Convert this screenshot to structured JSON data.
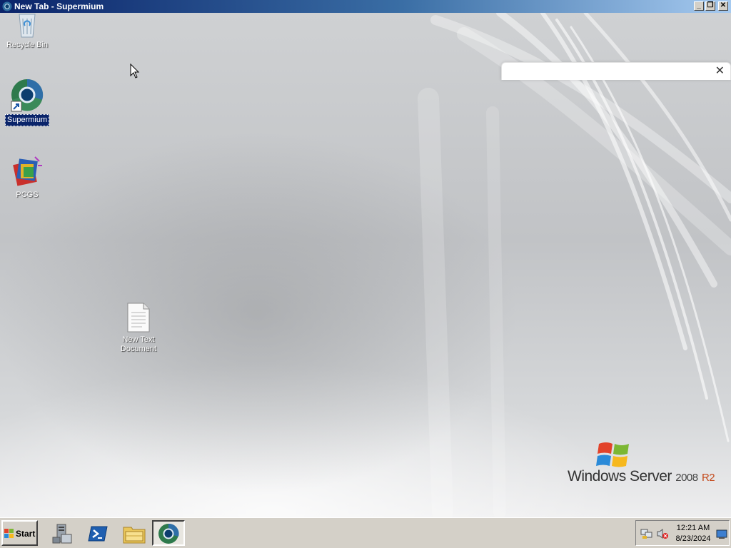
{
  "window": {
    "title": "New Tab - Supermium",
    "minimize_glyph": "_",
    "maximize_glyph": "❐",
    "close_glyph": "✕"
  },
  "desktop": {
    "icons": [
      {
        "label": "Recycle Bin",
        "icon": "recycle-bin-icon",
        "selected": false
      },
      {
        "label": "Supermium",
        "icon": "supermium-icon",
        "selected": true
      },
      {
        "label": "PCGS",
        "icon": "pcgs-icon",
        "selected": false
      },
      {
        "label": "New Text Document",
        "icon": "text-document-icon",
        "selected": false
      }
    ],
    "popup": {
      "close_glyph": "✕"
    },
    "logo": {
      "brand": "Windows Server",
      "version": "2008",
      "edition": "R2"
    }
  },
  "taskbar": {
    "start_label": "Start",
    "pinned": [
      {
        "icon": "server-manager-icon"
      },
      {
        "icon": "powershell-icon"
      },
      {
        "icon": "file-explorer-icon"
      },
      {
        "icon": "supermium-icon",
        "active": true
      }
    ],
    "tray": {
      "icons": [
        "network-icon",
        "volume-muted-icon",
        "show-desktop-icon"
      ],
      "time": "12:21 AM",
      "date": "8/23/2024"
    }
  },
  "colors": {
    "titlebar_start": "#0b246a",
    "titlebar_end": "#a6caf0",
    "selection": "#0a246a",
    "taskbar": "#d4d0c8",
    "r2_accent": "#c44a1c"
  }
}
